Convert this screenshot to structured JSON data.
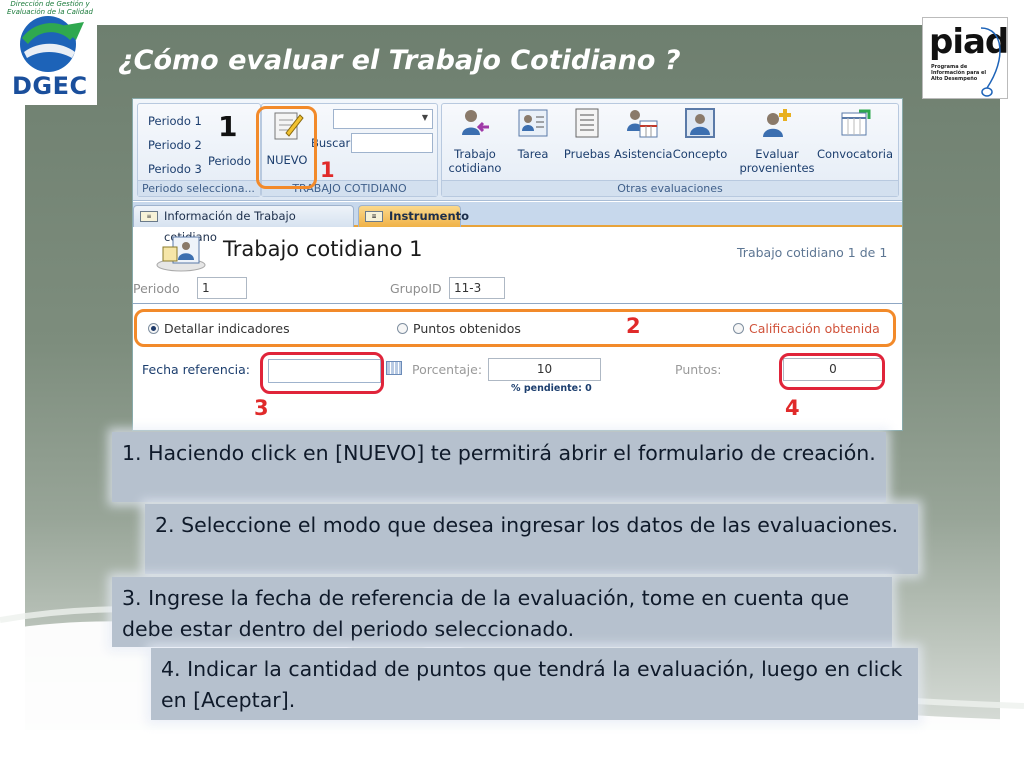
{
  "slide": {
    "title": "¿Cómo evaluar el Trabajo Cotidiano ?",
    "logo_left": {
      "name": "DGEC",
      "arc_text": "Dirección de Gestión y Evaluación de la Calidad"
    },
    "logo_right": {
      "name": "piad",
      "subtitle": "Programa de Información para el Alto Desempeño"
    }
  },
  "ribbon": {
    "periodo_group": {
      "items": [
        "Periodo 1",
        "Periodo 2",
        "Periodo 3"
      ],
      "periodo_button": "Periodo",
      "label": "Periodo selecciona..."
    },
    "trabajo_group": {
      "nuevo_button": "NUEVO",
      "buscar_label": "Buscar",
      "label": "TRABAJO COTIDIANO"
    },
    "otras_group": {
      "buttons": [
        {
          "label": "Trabajo\ncotidiano",
          "icon": "person-arrow-icon"
        },
        {
          "label": "Tarea",
          "icon": "person-list-icon"
        },
        {
          "label": "Pruebas",
          "icon": "document-lines-icon"
        },
        {
          "label": "Asistencia",
          "icon": "person-calendar-icon"
        },
        {
          "label": "Concepto",
          "icon": "person-portrait-icon"
        },
        {
          "label": "Evaluar\nprovenientes",
          "icon": "person-plus-icon"
        },
        {
          "label": "Convocatoria",
          "icon": "calendar-arrow-icon"
        }
      ],
      "label": "Otras evaluaciones"
    }
  },
  "tabs": [
    {
      "label": "Información de Trabajo cotidiano",
      "active": false
    },
    {
      "label": "Instrumento",
      "active": true
    }
  ],
  "form": {
    "title": "Trabajo cotidiano 1",
    "record_count": "Trabajo cotidiano 1 de 1",
    "periodo_label": "Periodo",
    "periodo_value": "1",
    "grupo_label": "GrupoID",
    "grupo_value": "11-3",
    "modes": [
      {
        "label": "Detallar indicadores",
        "selected": true
      },
      {
        "label": "Puntos obtenidos",
        "selected": false
      },
      {
        "label": "Calificación obtenida",
        "selected": false
      }
    ],
    "fecha_label": "Fecha referencia:",
    "fecha_value": "",
    "porcentaje_label": "Porcentaje:",
    "porcentaje_value": "10",
    "pendiente_note": "% pendiente: 0",
    "puntos_label": "Puntos:",
    "puntos_value": "0"
  },
  "annotations": {
    "ribbon_number": "1",
    "nuevo_number": "1",
    "mode_number": "2",
    "fecha_number": "3",
    "puntos_number": "4"
  },
  "callouts": [
    "1. Haciendo click en [NUEVO] te permitirá abrir el formulario de creación.",
    "2. Seleccione el modo que desea ingresar los datos de las evaluaciones.",
    "3. Ingrese la fecha de referencia de la evaluación, tome en cuenta que debe estar dentro del periodo seleccionado.",
    "4. Indicar la cantidad de puntos que tendrá la evaluación, luego en click en [Aceptar]."
  ],
  "colors": {
    "highlight_orange": "#f28a2a",
    "highlight_red": "#e0243a",
    "annotation_number": "#e02a2a",
    "active_tab": "#f0b247"
  }
}
